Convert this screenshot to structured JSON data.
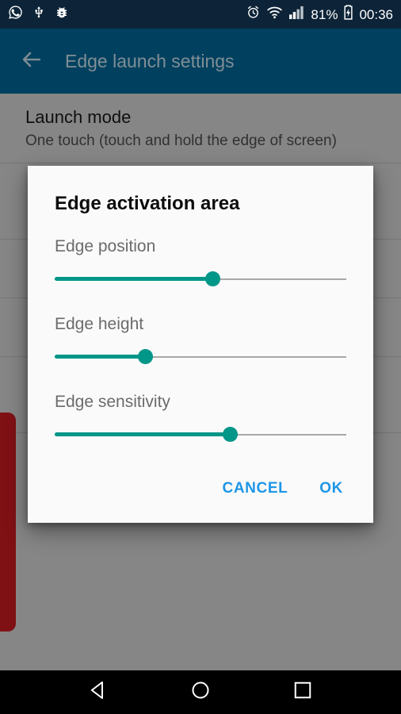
{
  "status_bar": {
    "left_icons": [
      {
        "name": "whatsapp-icon"
      },
      {
        "name": "usb-icon"
      },
      {
        "name": "android-debug-bug-icon"
      }
    ],
    "right_icons": [
      {
        "name": "alarm-clock-icon"
      },
      {
        "name": "wifi-icon"
      },
      {
        "name": "cellular-signal-icon"
      }
    ],
    "battery_percent": "81%",
    "battery_icon": "battery-charging-icon",
    "clock": "00:36",
    "background_color": "#0d2438"
  },
  "app_bar": {
    "back_icon": "arrow-back-icon",
    "title": "Edge launch settings",
    "background_color": "#01415f"
  },
  "content": {
    "preferences": [
      {
        "title": "Launch mode",
        "summary": "One touch (touch and hold the edge of screen)"
      }
    ],
    "edge_indicator": {
      "name": "edge-activation-indicator",
      "color": "#e71f27"
    }
  },
  "dialog": {
    "title": "Edge activation area",
    "background_color": "#fafafa",
    "accent_color": "#009688",
    "sliders": [
      {
        "label": "Edge position",
        "value": 54
      },
      {
        "label": "Edge height",
        "value": 31
      },
      {
        "label": "Edge sensitivity",
        "value": 60
      }
    ],
    "buttons": {
      "cancel": "CANCEL",
      "ok": "OK",
      "color": "#1e96e8"
    }
  },
  "nav_bar": {
    "back": "back-triangle-icon",
    "home": "home-circle-icon",
    "recents": "recents-square-icon",
    "background_color": "#000000"
  }
}
